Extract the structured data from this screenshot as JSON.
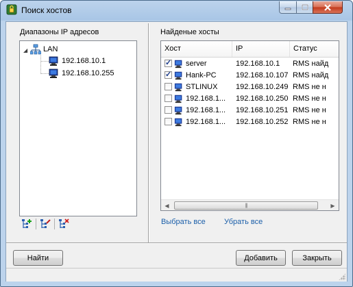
{
  "window": {
    "title": "Поиск хостов"
  },
  "left_pane": {
    "label": "Диапазоны IP адресов",
    "tree": {
      "root": "LAN",
      "children": [
        "192.168.10.1",
        "192.168.10.255"
      ]
    }
  },
  "right_pane": {
    "label": "Найденые хосты",
    "columns": [
      "Хост",
      "IP",
      "Статус"
    ],
    "rows": [
      {
        "checked": true,
        "host": "server",
        "ip": "192.168.10.1",
        "status": "RMS найд"
      },
      {
        "checked": true,
        "host": "Hank-PC",
        "ip": "192.168.10.107",
        "status": "RMS найд"
      },
      {
        "checked": false,
        "host": "STLINUX",
        "ip": "192.168.10.249",
        "status": "RMS не н"
      },
      {
        "checked": false,
        "host": "192.168.1...",
        "ip": "192.168.10.250",
        "status": "RMS не н"
      },
      {
        "checked": false,
        "host": "192.168.1...",
        "ip": "192.168.10.251",
        "status": "RMS не н"
      },
      {
        "checked": false,
        "host": "192.168.1...",
        "ip": "192.168.10.252",
        "status": "RMS не н"
      }
    ],
    "select_all": "Выбрать все",
    "deselect_all": "Убрать все"
  },
  "buttons": {
    "find": "Найти",
    "add": "Добавить",
    "close": "Закрыть"
  },
  "icons": [
    "app-icon",
    "minimize-icon",
    "maximize-icon",
    "close-icon",
    "network-icon",
    "computer-icon",
    "add-range-icon",
    "edit-range-icon",
    "delete-range-icon"
  ]
}
